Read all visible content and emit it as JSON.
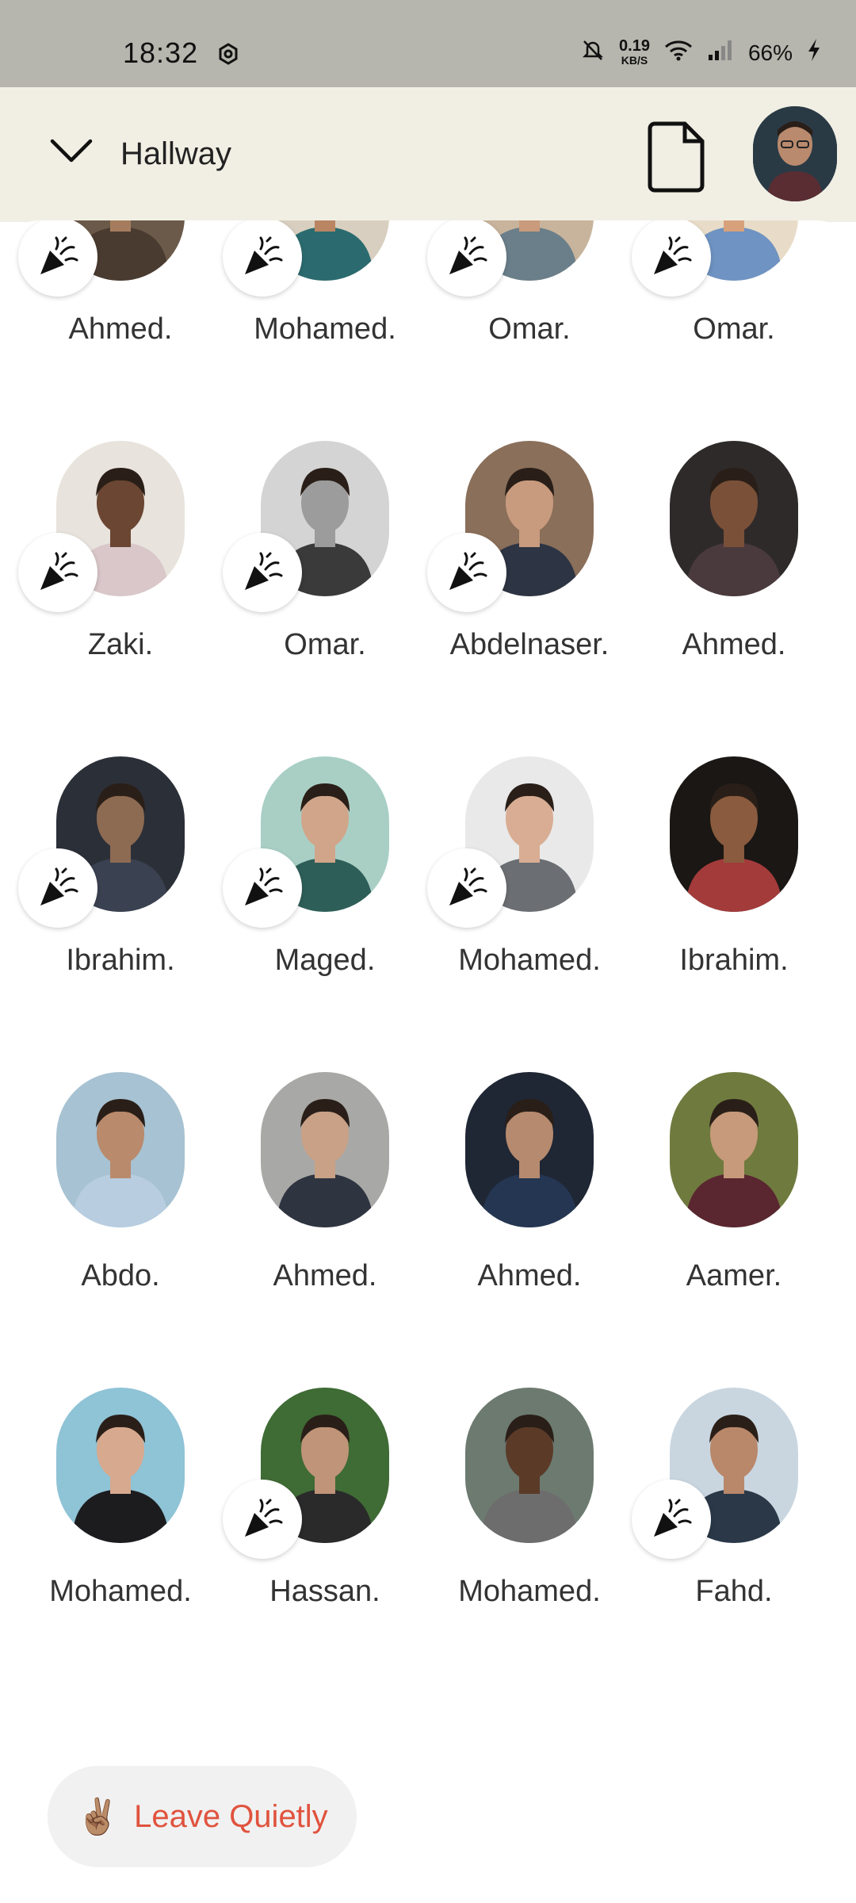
{
  "status_bar": {
    "time": "18:32",
    "speed_value": "0.19",
    "speed_unit": "KB/S",
    "battery": "66%",
    "icons": [
      "settings-icon",
      "bell-off-icon",
      "wifi-icon",
      "signal-icon",
      "charging-icon"
    ]
  },
  "header": {
    "title": "Hallway",
    "collapse_icon": "chevron-down-icon",
    "document_icon": "document-icon"
  },
  "people": [
    {
      "name": "Ahmed.",
      "reaction": true,
      "bg": "#6b5a4a",
      "skin": "#a57d5e",
      "shirt": "#4a3b30"
    },
    {
      "name": "Mohamed.",
      "reaction": true,
      "bg": "#d9cfc0",
      "skin": "#b98563",
      "shirt": "#2b6b6f"
    },
    {
      "name": "Omar.",
      "reaction": true,
      "bg": "#c8b49c",
      "skin": "#c99a7b",
      "shirt": "#6a7f8a"
    },
    {
      "name": "Omar.",
      "reaction": true,
      "bg": "#e8dcc8",
      "skin": "#d7a17c",
      "shirt": "#6f93c2"
    },
    {
      "name": "Zaki.",
      "reaction": true,
      "bg": "#e8e3dc",
      "skin": "#6b4632",
      "shirt": "#d9c7c9"
    },
    {
      "name": "Omar.",
      "reaction": true,
      "bg": "#d4d4d4",
      "skin": "#9c9c9c",
      "shirt": "#3a3a3a"
    },
    {
      "name": "Abdelnaser.",
      "reaction": true,
      "bg": "#8a6f5a",
      "skin": "#c89b7e",
      "shirt": "#2d3443"
    },
    {
      "name": "Ahmed.",
      "reaction": false,
      "bg": "#2f2a2a",
      "skin": "#7a5038",
      "shirt": "#4a3a3e"
    },
    {
      "name": "Ibrahim.",
      "reaction": true,
      "bg": "#2b2f38",
      "skin": "#8d6a52",
      "shirt": "#3a4150"
    },
    {
      "name": "Maged.",
      "reaction": true,
      "bg": "#a9cfc5",
      "skin": "#d1a58a",
      "shirt": "#2e5e58"
    },
    {
      "name": "Mohamed.",
      "reaction": true,
      "bg": "#e9e9ea",
      "skin": "#d8ad93",
      "shirt": "#6b6e72"
    },
    {
      "name": "Ibrahim.",
      "reaction": false,
      "bg": "#1a1714",
      "skin": "#8a5b3e",
      "shirt": "#a33b3b"
    },
    {
      "name": "Abdo.",
      "reaction": false,
      "bg": "#a7c2d2",
      "skin": "#b98a6c",
      "shirt": "#b8cde0"
    },
    {
      "name": "Ahmed.",
      "reaction": false,
      "bg": "#a8a8a6",
      "skin": "#c9a186",
      "shirt": "#2e3440"
    },
    {
      "name": "Ahmed.",
      "reaction": false,
      "bg": "#1f2634",
      "skin": "#b58a6e",
      "shirt": "#243652"
    },
    {
      "name": "Aamer.",
      "reaction": false,
      "bg": "#6f7a3e",
      "skin": "#c69a7a",
      "shirt": "#5a2630"
    },
    {
      "name": "Mohamed.",
      "reaction": false,
      "bg": "#8fc3d6",
      "skin": "#d7a98e",
      "shirt": "#1c1c1e"
    },
    {
      "name": "Hassan.",
      "reaction": true,
      "bg": "#3f6b35",
      "skin": "#c09478",
      "shirt": "#2a2a2a"
    },
    {
      "name": "Mohamed.",
      "reaction": false,
      "bg": "#6c7a70",
      "skin": "#5b3a28",
      "shirt": "#6d6d6d"
    },
    {
      "name": "Fahd.",
      "reaction": true,
      "bg": "#c9d6e0",
      "skin": "#b9876a",
      "shirt": "#2a3848"
    }
  ],
  "reaction_icon": "party-popper-icon",
  "footer": {
    "leave_emoji": "✌🏽",
    "leave_label": "Leave Quietly"
  },
  "colors": {
    "status_bar_bg": "#b6b6ae",
    "header_bg": "#f1efe4",
    "leave_text": "#e0533e",
    "leave_bg": "#f1f1f1"
  }
}
